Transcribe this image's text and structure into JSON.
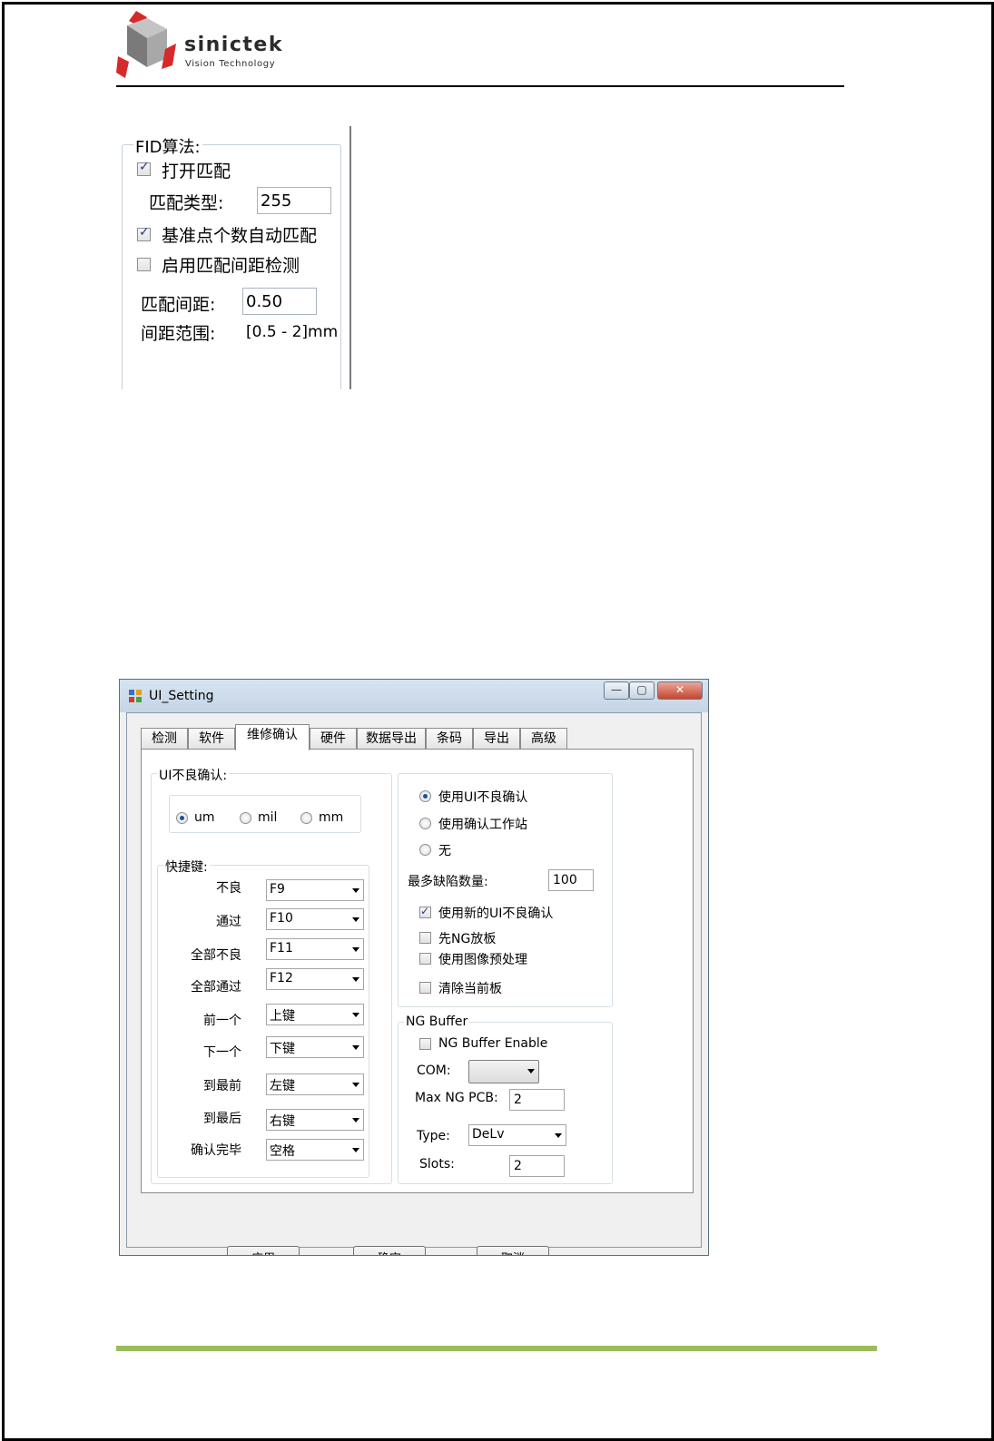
{
  "logo": {
    "name": "sinictek",
    "tagline": "Vision Technology"
  },
  "fid": {
    "group_title": "FID算法:",
    "open_match": {
      "label": "打开匹配",
      "checked": true
    },
    "match_type": {
      "label": "匹配类型:",
      "value": "255"
    },
    "auto_match": {
      "label": "基准点个数自动匹配",
      "checked": true
    },
    "spacing_check": {
      "label": "启用匹配间距检测",
      "checked": false
    },
    "match_spacing": {
      "label": "匹配间距:",
      "value": "0.50"
    },
    "range": {
      "label": "间距范围:",
      "value": "[0.5 - 2]mm"
    }
  },
  "dialog": {
    "title": "UI_Setting",
    "window_buttons": {
      "minimize": "—",
      "restore": "▢",
      "close": "✕"
    },
    "tabs": [
      "检测",
      "软件",
      "维修确认",
      "硬件",
      "数据导出",
      "条码",
      "导出",
      "高级"
    ],
    "active_tab": "维修确认",
    "ui_confirm": {
      "title": "UI不良确认:",
      "units": [
        "um",
        "mil",
        "mm"
      ],
      "selected_unit": "um"
    },
    "shortcuts": {
      "title": "快捷键:",
      "rows": [
        {
          "label": "不良",
          "value": "F9"
        },
        {
          "label": "通过",
          "value": "F10"
        },
        {
          "label": "全部不良",
          "value": "F11"
        },
        {
          "label": "全部通过",
          "value": "F12"
        },
        {
          "label": "前一个",
          "value": "上键"
        },
        {
          "label": "下一个",
          "value": "下键"
        },
        {
          "label": "到最前",
          "value": "左键"
        },
        {
          "label": "到最后",
          "value": "右键"
        },
        {
          "label": "确认完毕",
          "value": "空格"
        }
      ]
    },
    "mode": {
      "options": [
        "使用UI不良确认",
        "使用确认工作站",
        "无"
      ],
      "selected": "使用UI不良确认",
      "max_defects": {
        "label": "最多缺陷数量:",
        "value": "100"
      },
      "checks": [
        {
          "label": "使用新的UI不良确认",
          "checked": true
        },
        {
          "label": "先NG放板",
          "checked": false
        },
        {
          "label": "使用图像预处理",
          "checked": false
        },
        {
          "label": "清除当前板",
          "checked": false
        }
      ]
    },
    "ng_buffer": {
      "title": "NG Buffer",
      "enable": {
        "label": "NG Buffer Enable",
        "checked": false
      },
      "com": {
        "label": "COM:",
        "value": ""
      },
      "max_ng": {
        "label": "Max NG PCB:",
        "value": "2"
      },
      "type": {
        "label": "Type:",
        "value": "DeLv"
      },
      "slots": {
        "label": "Slots:",
        "value": "2"
      }
    },
    "buttons": {
      "apply": "应用",
      "ok": "确定",
      "cancel": "取消"
    }
  },
  "colors": {
    "footer_rule": "#9bbb59",
    "logo_red": "#d62a2a",
    "logo_gray": "#9a9a9a"
  }
}
